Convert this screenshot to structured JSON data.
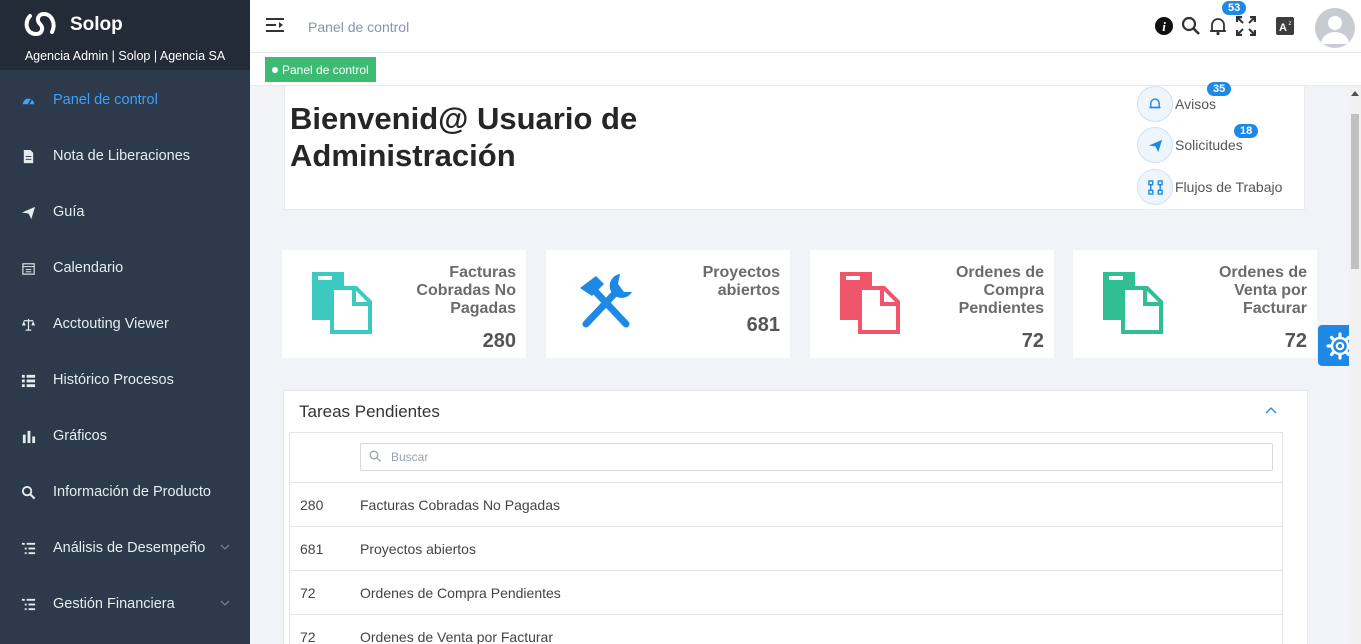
{
  "brand": {
    "name": "Solop",
    "subtitle": "Agencia Admin | Solop | Agencia SA"
  },
  "sidebar": {
    "items": [
      {
        "label": "Panel de control",
        "icon": "dashboard-icon",
        "active": true
      },
      {
        "label": "Nota de Liberaciones",
        "icon": "document-icon"
      },
      {
        "label": "Guía",
        "icon": "paper-plane-icon"
      },
      {
        "label": "Calendario",
        "icon": "calendar-icon"
      },
      {
        "label": "Acctouting Viewer",
        "icon": "scale-icon"
      },
      {
        "label": "Histórico Procesos",
        "icon": "list-icon"
      },
      {
        "label": "Gráficos",
        "icon": "bar-chart-icon"
      },
      {
        "label": "Información de Producto",
        "icon": "search-icon"
      },
      {
        "label": "Análisis de Desempeño",
        "icon": "tree-list-icon",
        "expandable": true
      },
      {
        "label": "Gestión Financiera",
        "icon": "tree-list-icon",
        "expandable": true
      }
    ]
  },
  "topbar": {
    "breadcrumb": "Panel de control",
    "notifications_count": "53",
    "icons": [
      "info-icon",
      "search-icon",
      "bell-icon",
      "fullscreen-icon",
      "translate-icon",
      "avatar"
    ]
  },
  "crumbbar": {
    "label": "Panel de control"
  },
  "welcome": {
    "title": "Bienvenid@ Usuario de Administración",
    "links": [
      {
        "label": "Avisos",
        "badge": "35",
        "icon": "bell-icon"
      },
      {
        "label": "Solicitudes",
        "badge": "18",
        "icon": "paper-plane-icon"
      },
      {
        "label": "Flujos de Trabajo",
        "badge": "",
        "icon": "workflow-icon"
      }
    ]
  },
  "stats": [
    {
      "label": "Facturas Cobradas No Pagadas",
      "value": "280",
      "icon": "documents-icon",
      "color": "#3cc9c0"
    },
    {
      "label": "Proyectos abiertos",
      "value": "681",
      "icon": "tools-icon",
      "color": "#1e88e5"
    },
    {
      "label": "Ordenes de Compra Pendientes",
      "value": "72",
      "icon": "documents-icon",
      "color": "#f0566b"
    },
    {
      "label": "Ordenes de Venta por Facturar",
      "value": "72",
      "icon": "documents-icon",
      "color": "#2fbf91"
    }
  ],
  "tasks": {
    "title": "Tareas Pendientes",
    "search_placeholder": "Buscar",
    "rows": [
      {
        "count": "280",
        "name": "Facturas Cobradas No Pagadas"
      },
      {
        "count": "681",
        "name": "Proyectos abiertos"
      },
      {
        "count": "72",
        "name": "Ordenes de Compra Pendientes"
      },
      {
        "count": "72",
        "name": "Ordenes de Venta por Facturar"
      }
    ]
  },
  "colors": {
    "sidebar": "#2c3a4b",
    "accent": "#1e88e5",
    "active": "#3ea0ff",
    "crumb": "#3dbb73"
  }
}
